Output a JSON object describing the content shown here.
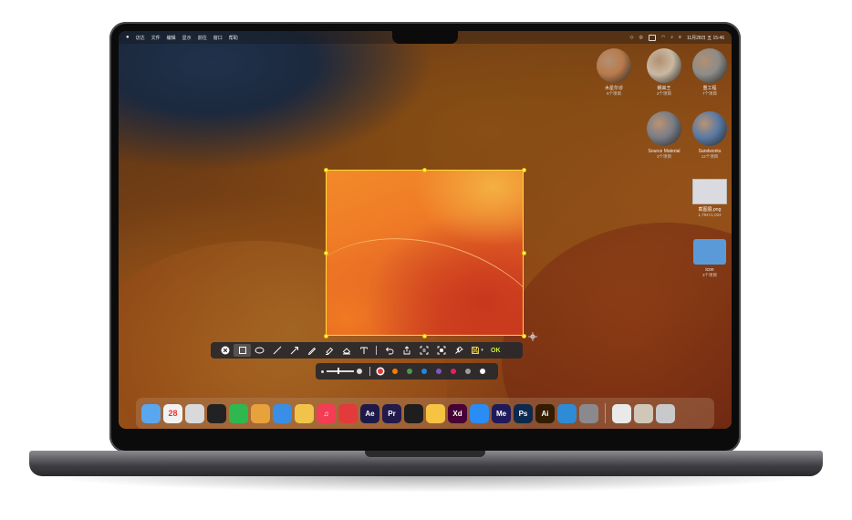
{
  "menubar": {
    "left_items": [
      "访达",
      "文件",
      "编辑",
      "显示",
      "前往",
      "窗口",
      "帮助"
    ],
    "clock": "11月28日 五  15:46"
  },
  "desktop_icons": [
    {
      "name": "木星尔诊",
      "sub": "5个项目",
      "color": "#b87a4c"
    },
    {
      "name": "朝来王",
      "sub": "2个项目",
      "color": "#c9b9a2"
    },
    {
      "name": "重工程",
      "sub": "7个项目",
      "color": "#8c8c88"
    },
    {
      "name": "Source Material",
      "sub": "3个项目",
      "color": "#7a7d86"
    },
    {
      "name": "Sandworks",
      "sub": "12个项目",
      "color": "#5a7aa4"
    },
    {
      "name": "截图展.png",
      "sub": "1,784×1,024",
      "color": "#d9dbe0"
    },
    {
      "name": "icon",
      "sub": "3个项目",
      "color": "#5b9ad8"
    }
  ],
  "toolbar": {
    "tools": [
      "close",
      "rectangle",
      "ellipse",
      "line",
      "arrow",
      "pen",
      "marker",
      "eraser",
      "text",
      "undo",
      "share",
      "ocr",
      "fullscreen",
      "pin",
      "save"
    ],
    "ok_label": "OK"
  },
  "colorbar": {
    "colors": [
      "#e53935",
      "#f57c00",
      "#43a047",
      "#1e88e5",
      "#7e57c2",
      "#e91e63",
      "#9e9e9e",
      "#ffffff"
    ],
    "selected_color": "#e53935"
  },
  "dock": {
    "calendar_day": "28",
    "apps": [
      {
        "name": "Finder",
        "label": "",
        "color": "#5aa7f0"
      },
      {
        "name": "Calendar",
        "label": "28",
        "color": "#f2f2f2"
      },
      {
        "name": "Launchpad",
        "label": "",
        "color": "#d9d9dc"
      },
      {
        "name": "QQ",
        "label": "",
        "color": "#222"
      },
      {
        "name": "WeChat",
        "label": "",
        "color": "#2fb84f"
      },
      {
        "name": "Chrome",
        "label": "",
        "color": "#e8a23b"
      },
      {
        "name": "Safari",
        "label": "",
        "color": "#3a8ee6"
      },
      {
        "name": "Photos",
        "label": "",
        "color": "#f2c34a"
      },
      {
        "name": "Music",
        "label": "♫",
        "color": "#f43c55"
      },
      {
        "name": "NetEase",
        "label": "",
        "color": "#e33b3b"
      },
      {
        "name": "After Effects",
        "label": "Ae",
        "color": "#1d1a4a"
      },
      {
        "name": "Premiere",
        "label": "Pr",
        "color": "#221a4a"
      },
      {
        "name": "Figma",
        "label": "",
        "color": "#1e1e1e"
      },
      {
        "name": "Sketch",
        "label": "",
        "color": "#f7c343"
      },
      {
        "name": "Adobe XD",
        "label": "Xd",
        "color": "#470137"
      },
      {
        "name": "App Store",
        "label": "",
        "color": "#2a8cf4"
      },
      {
        "name": "Media Encoder",
        "label": "Me",
        "color": "#1f1a5c"
      },
      {
        "name": "Photoshop",
        "label": "Ps",
        "color": "#0b2a4d"
      },
      {
        "name": "Illustrator",
        "label": "Ai",
        "color": "#331c00"
      },
      {
        "name": "Edge",
        "label": "",
        "color": "#2e8bd6"
      },
      {
        "name": "Settings",
        "label": "",
        "color": "#8a8a8e"
      },
      {
        "name": "Preview",
        "label": "",
        "color": "#e9e9ea"
      },
      {
        "name": "Folder Stack",
        "label": "",
        "color": "#d0c7b8"
      },
      {
        "name": "Trash",
        "label": "",
        "color": "#c9c9cc"
      }
    ]
  }
}
